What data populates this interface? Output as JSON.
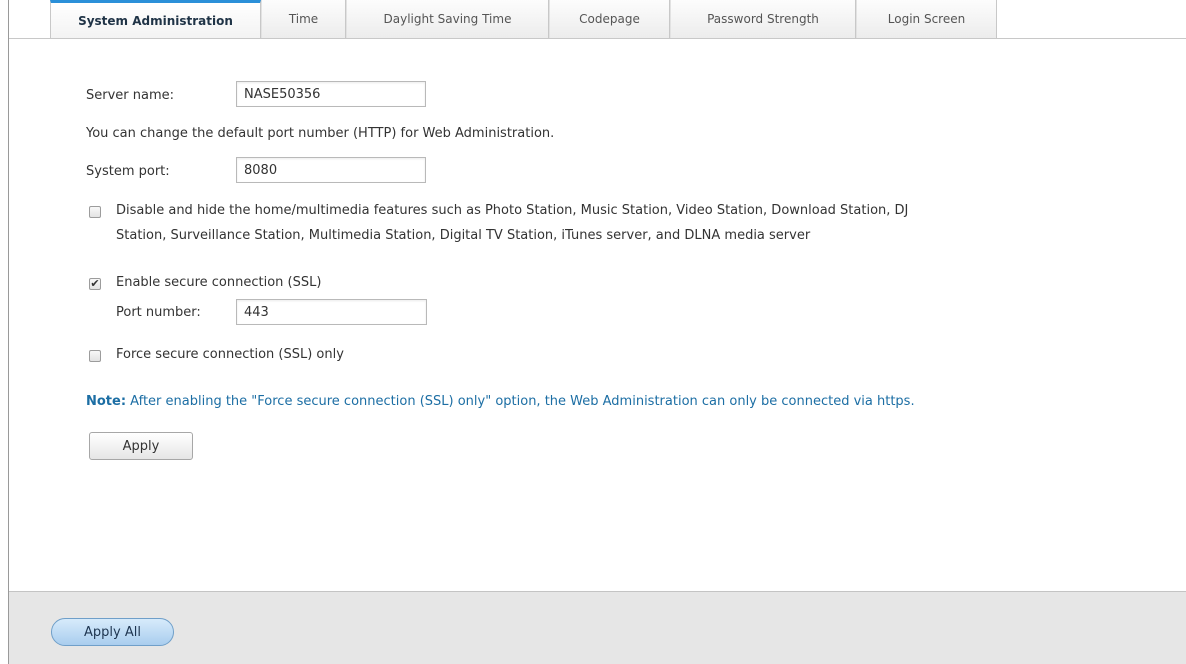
{
  "tabs": [
    {
      "label": "System Administration",
      "active": true
    },
    {
      "label": "Time",
      "active": false
    },
    {
      "label": "Daylight Saving Time",
      "active": false
    },
    {
      "label": "Codepage",
      "active": false
    },
    {
      "label": "Password Strength",
      "active": false
    },
    {
      "label": "Login Screen",
      "active": false
    }
  ],
  "form": {
    "server_name_label": "Server name:",
    "server_name_value": "NASE50356",
    "port_info": "You can change the default port number (HTTP) for Web Administration.",
    "system_port_label": "System port:",
    "system_port_value": "8080",
    "disable_features_checked": false,
    "disable_features_line1": "Disable and hide the home/multimedia features such as Photo Station, Music Station, Video Station, Download Station, DJ",
    "disable_features_line2": "Station, Surveillance Station, Multimedia Station, Digital TV Station, iTunes server, and DLNA media server",
    "ssl_checked": true,
    "ssl_label": "Enable secure connection (SSL)",
    "ssl_port_label": "Port number:",
    "ssl_port_value": "443",
    "force_ssl_checked": false,
    "force_ssl_label": "Force secure connection (SSL) only",
    "note_prefix": "Note:",
    "note_text": " After enabling the \"Force secure connection (SSL) only\" option, the Web Administration can only be connected via https.",
    "apply_label": "Apply"
  },
  "footer": {
    "apply_all_label": "Apply All"
  },
  "colors": {
    "active_tab_accent": "#2a8fd8",
    "note_text": "#1c6ea4",
    "footer_bg": "#e6e6e6"
  }
}
